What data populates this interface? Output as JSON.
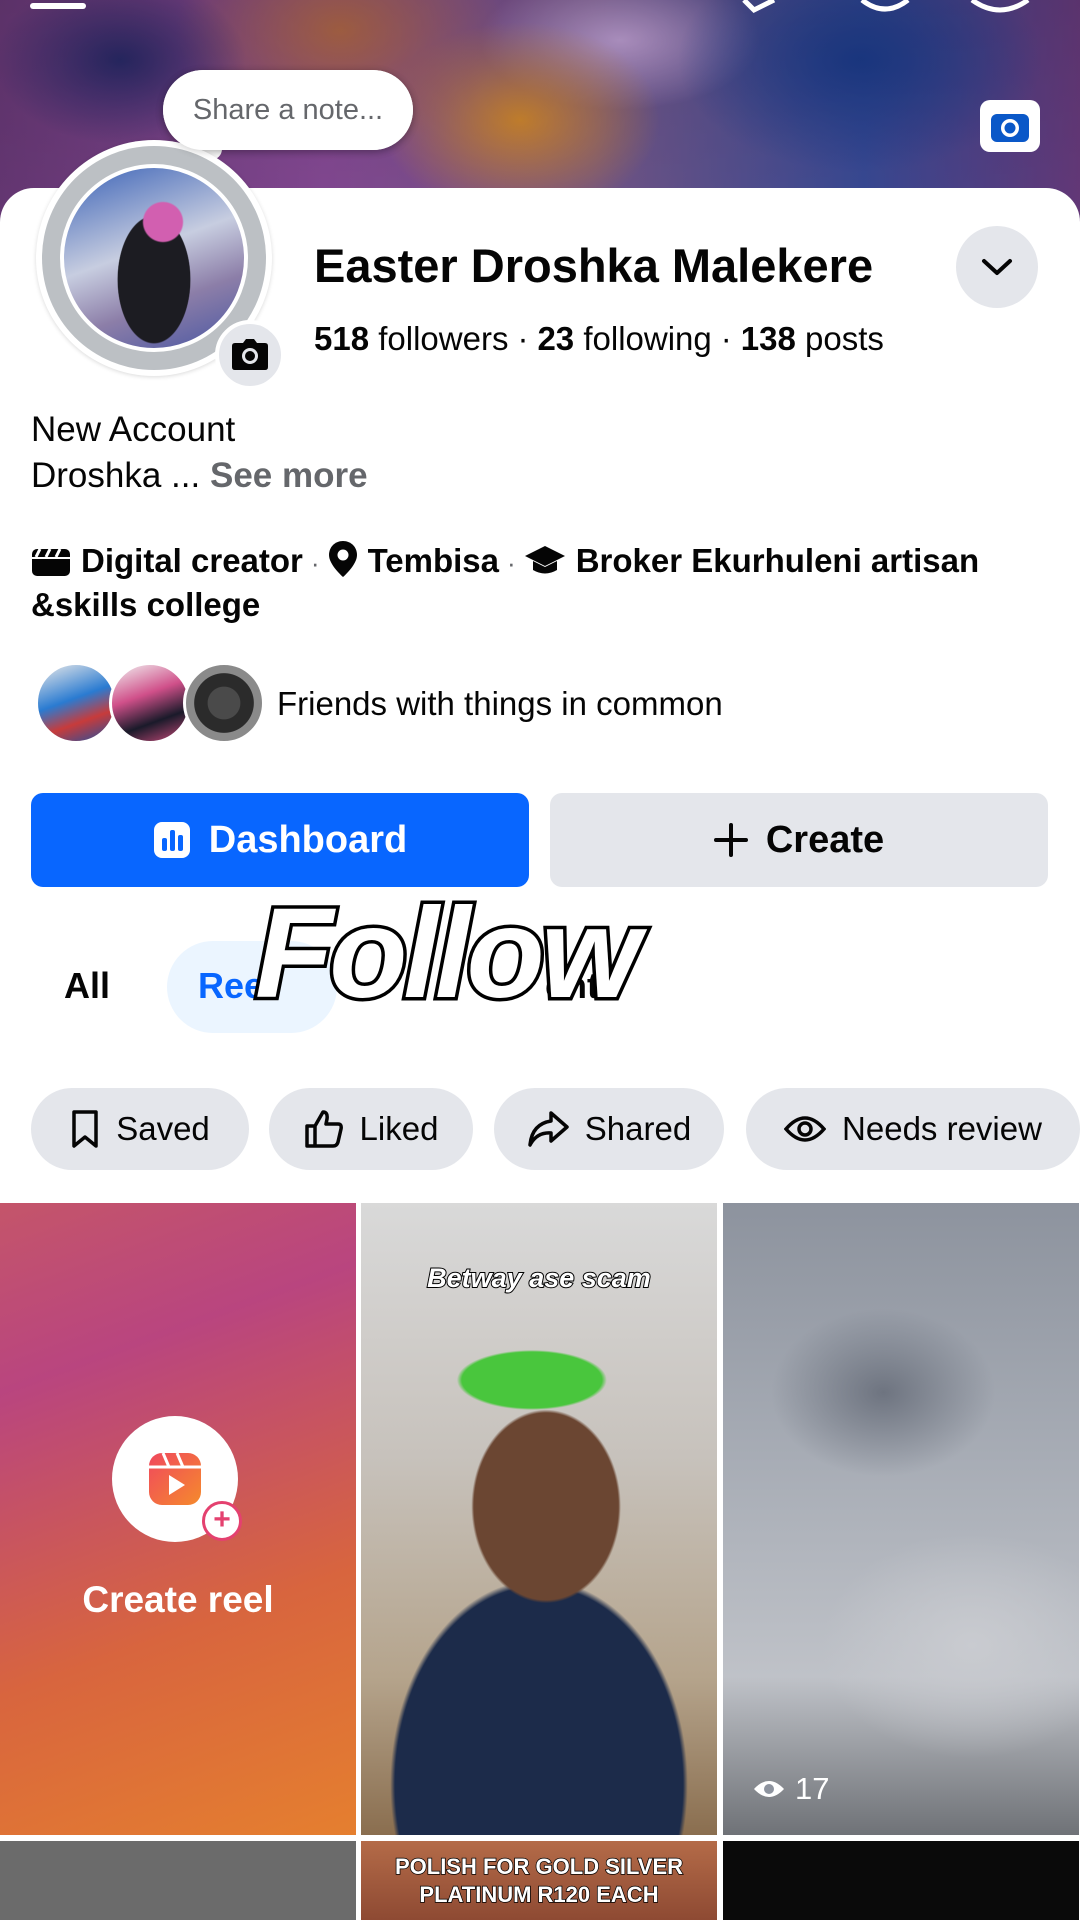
{
  "cover": {
    "note_placeholder": "Share a note..."
  },
  "profile": {
    "name": "Easter Droshka Malekere",
    "followers_count": "518",
    "followers_label": "followers",
    "following_count": "23",
    "following_label": "following",
    "posts_count": "138",
    "posts_label": "posts",
    "bio_line1": "New Account",
    "bio_line2": "Droshka ...",
    "see_more": "See more",
    "category": "Digital creator",
    "location": "Tembisa",
    "education": "Broker Ekurhuleni artisan &skills college",
    "friends_text": "Friends with things in common"
  },
  "actions": {
    "dashboard_label": "Dashboard",
    "create_label": "Create"
  },
  "tabs": {
    "all": "All",
    "reels": "Ree",
    "mentions": "ents"
  },
  "overlay_text": "Follow",
  "filters": [
    {
      "label": "Saved",
      "icon": "bookmark-icon"
    },
    {
      "label": "Liked",
      "icon": "thumbs-up-icon"
    },
    {
      "label": "Shared",
      "icon": "share-icon"
    },
    {
      "label": "Needs review",
      "icon": "eye-icon"
    }
  ],
  "grid": {
    "create_reel_label": "Create reel",
    "tile2_caption": "Betway ase scam",
    "tile3_views": "17",
    "bottom_tile2_text_line1": "POLISH FOR GOLD SILVER",
    "bottom_tile2_text_line2": "PLATINUM R120 EACH"
  },
  "colors": {
    "accent_blue": "#0866ff",
    "chip_gray": "#e4e6eb",
    "secondary_text": "#65676b"
  }
}
